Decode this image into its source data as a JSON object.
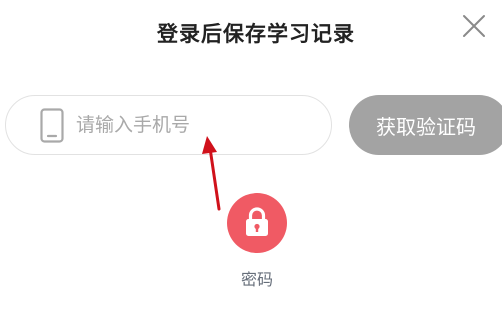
{
  "dialog": {
    "title": "登录后保存学习记录",
    "close_icon": "close-icon"
  },
  "phone": {
    "placeholder": "请输入手机号",
    "value": "",
    "icon": "mobile-phone-icon"
  },
  "code_button": {
    "label": "获取验证码"
  },
  "password_option": {
    "label": "密码",
    "icon": "lock-icon",
    "color": "#f05a64"
  },
  "colors": {
    "button_bg": "#a3a3a3",
    "annotation_arrow": "#d0111b"
  }
}
